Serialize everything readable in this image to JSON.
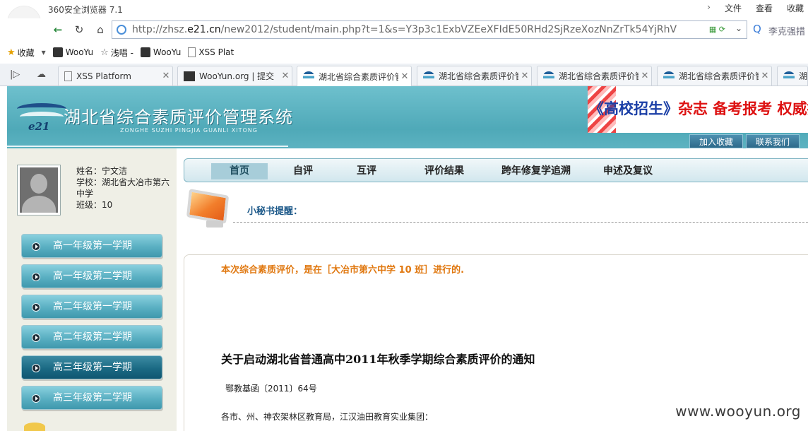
{
  "browser": {
    "app_title": "360安全浏览器 7.1",
    "menu": [
      "文件",
      "查看",
      "收藏"
    ],
    "url_prefix": "http://zhsz.",
    "url_domain": "e21.cn",
    "url_rest": "/new2012/student/main.php?t=1&s=Y3p3c1ExbVZEeXFIdE50RHd2SjRzeXozNnZrTk54YjRhV",
    "search_text": "李克强措",
    "bookmarks": [
      "收藏",
      "WooYu",
      "浅唱 -",
      "WooYu",
      "XSS Plat"
    ],
    "tabs": [
      {
        "title": "XSS Platform",
        "icon": "page-icon"
      },
      {
        "title": "WooYun.org | 提交",
        "icon": "wooyun-icon"
      },
      {
        "title": "湖北省综合素质评价管",
        "icon": "e21-icon"
      },
      {
        "title": "湖北省综合素质评价管",
        "icon": "e21-icon"
      },
      {
        "title": "湖北省综合素质评价管",
        "icon": "e21-icon"
      },
      {
        "title": "湖北省综合素质评价管",
        "icon": "e21-icon"
      },
      {
        "title": "湖",
        "icon": "e21-icon"
      }
    ]
  },
  "header": {
    "logo_text": "e21",
    "title": "湖北省综合素质评价管理系统",
    "subtitle": "ZONGHE SUZHI PINGJIA GUANLI XITONG",
    "ad_main": "《高校招生》",
    "ad_red": "杂志 备考报考 权威指导",
    "buttons": [
      "加入收藏",
      "联系我们"
    ]
  },
  "student": {
    "name": "姓名：宁文洁",
    "school": "学校：湖北省大冶市第六中学",
    "class": "班级：10"
  },
  "semesters": [
    "高一年级第一学期",
    "高一年级第二学期",
    "高二年级第一学期",
    "高二年级第二学期",
    "高三年级第一学期",
    "高三年级第二学期"
  ],
  "nav": [
    "首页",
    "自评",
    "互评",
    "评价结果",
    "跨年修复学追溯",
    "申述及复议"
  ],
  "reminder": "小秘书提醒：",
  "content": {
    "orange_text": "本次综合素质评价，是在［大冶市第六中学 10 班］进行的.",
    "notice_title": "关于启动湖北省普通高中2011年秋季学期综合素质评价的通知",
    "notice_no": "鄂教基函〔2011〕64号",
    "notice_to": "各市、州、神农架林区教育局，江汉油田教育实业集团："
  },
  "watermark": "www.wooyun.org"
}
